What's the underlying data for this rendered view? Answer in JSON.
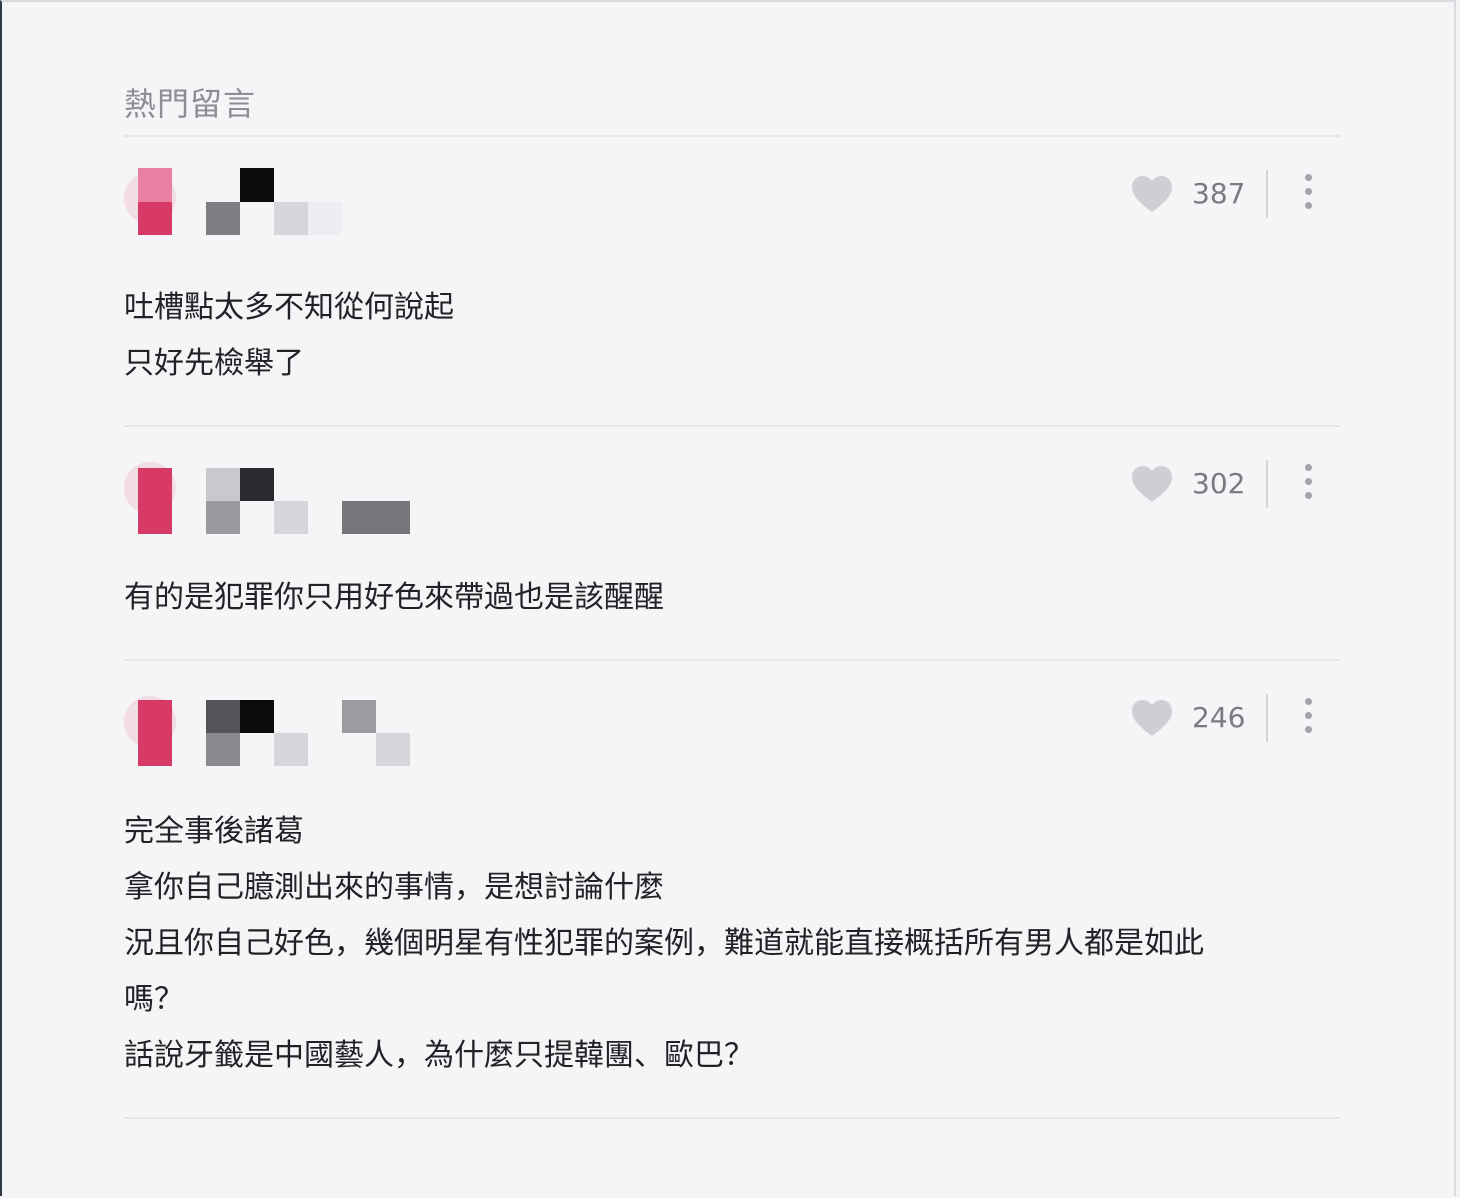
{
  "section_title": "熱門留言",
  "comments": [
    {
      "likes": "387",
      "lines": [
        "吐槽點太多不知從何說起",
        "只好先檢舉了"
      ]
    },
    {
      "likes": "302",
      "lines": [
        "有的是犯罪你只用好色來帶過也是該醒醒"
      ]
    },
    {
      "likes": "246",
      "lines": [
        "完全事後諸葛",
        "拿你自己臆測出來的事情，是想討論什麼",
        "況且你自己好色，幾個明星有性犯罪的案例，難道就能直接概括所有男人都是如此",
        "嗎？",
        "話說牙籤是中國藝人，為什麼只提韓團、歐巴？"
      ]
    }
  ],
  "icons": {
    "like": "heart-icon",
    "menu": "more-vertical-icon"
  },
  "colors": {
    "background": "#f5f4f7",
    "heart": "#cfcfd3",
    "avatar_accent": "#d93c6b"
  }
}
